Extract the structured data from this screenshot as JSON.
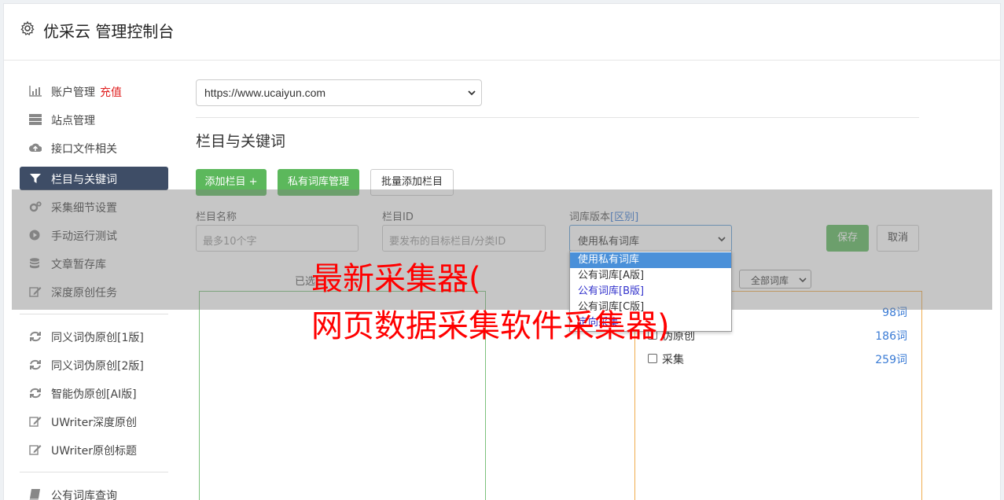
{
  "header": {
    "title": "优采云 管理控制台",
    "icon": "gear-icon"
  },
  "sidebar": {
    "items": [
      {
        "label": "账户管理",
        "badge": "充值",
        "icon": "bar-chart-icon"
      },
      {
        "label": "站点管理",
        "icon": "server-icon"
      },
      {
        "label": "接口文件相关",
        "icon": "cloud-upload-icon"
      },
      {
        "label": "栏目与关键词",
        "icon": "filter-icon",
        "active": true
      },
      {
        "label": "采集细节设置",
        "icon": "cogs-icon"
      },
      {
        "label": "手动运行测试",
        "icon": "play-circle-icon"
      },
      {
        "label": "文章暂存库",
        "icon": "database-icon"
      },
      {
        "label": "深度原创任务",
        "icon": "edit-icon"
      },
      {
        "label": "同义词伪原创[1版]",
        "icon": "refresh-icon"
      },
      {
        "label": "同义词伪原创[2版]",
        "icon": "refresh-icon"
      },
      {
        "label": "智能伪原创[AI版]",
        "icon": "refresh-icon"
      },
      {
        "label": "UWriter深度原创",
        "icon": "edit-icon"
      },
      {
        "label": "UWriter原创标题",
        "icon": "edit-icon"
      },
      {
        "label": "公有词库查询",
        "icon": "book-icon"
      }
    ]
  },
  "main": {
    "site_select": "https://www.ucaiyun.com",
    "section_title": "栏目与关键词",
    "buttons": {
      "add_column": "添加栏目 +",
      "private_lib": "私有词库管理",
      "batch_add": "批量添加栏目",
      "save": "保存",
      "cancel": "取消"
    },
    "fields": {
      "name_label": "栏目名称",
      "name_placeholder": "最多10个字",
      "id_label": "栏目ID",
      "id_placeholder": "要发布的目标栏目/分类ID",
      "version_label": "词库版本",
      "version_link": "[区别]",
      "version_selected": "使用私有词库"
    },
    "dropdown_options": [
      "使用私有词库",
      "公有词库[A版]",
      "公有词库[B版]",
      "公有词库[C版]",
      "定向采集"
    ],
    "selected_label": "已选",
    "library_filter": "全部词库",
    "keywords": [
      {
        "name": "",
        "count": "98词"
      },
      {
        "name": "伪原创",
        "count": "186词"
      },
      {
        "name": "采集",
        "count": "259词"
      }
    ]
  },
  "watermark": {
    "line1": "最新采集器(",
    "line2": "网页数据采集软件采集器)"
  },
  "colors": {
    "green": "#5cb85c",
    "active_nav": "#3e4d66",
    "link": "#3a7bd5",
    "watermark": "#ff0000"
  }
}
